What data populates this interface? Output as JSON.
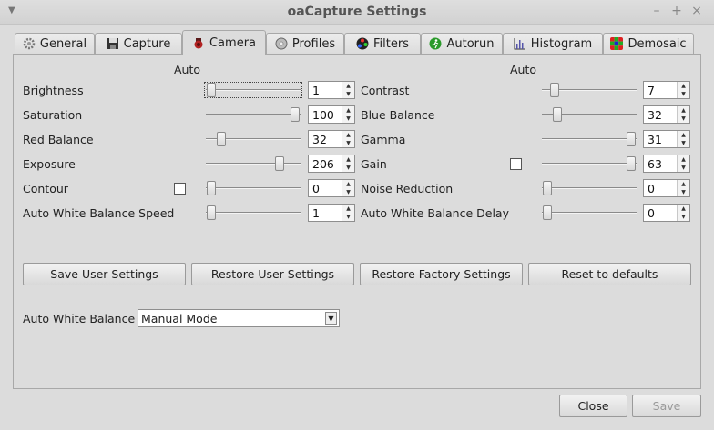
{
  "window": {
    "title": "oaCapture Settings",
    "menu_icon": "chevron-down-icon",
    "minimize_glyph": "–",
    "maximize_glyph": "+",
    "close_glyph": "×"
  },
  "tabs": [
    {
      "label": "General",
      "icon": "gear-icon"
    },
    {
      "label": "Capture",
      "icon": "floppy-icon"
    },
    {
      "label": "Camera",
      "icon": "camera-icon",
      "active": true
    },
    {
      "label": "Profiles",
      "icon": "disc-icon"
    },
    {
      "label": "Filters",
      "icon": "filter-wheel-icon"
    },
    {
      "label": "Autorun",
      "icon": "running-man-icon"
    },
    {
      "label": "Histogram",
      "icon": "histogram-icon"
    },
    {
      "label": "Demosaic",
      "icon": "bayer-grid-icon"
    }
  ],
  "camera": {
    "auto_header_left": "Auto",
    "auto_header_right": "Auto",
    "left_controls": [
      {
        "label": "Brightness",
        "value": "1"
      },
      {
        "label": "Saturation",
        "value": "100"
      },
      {
        "label": "Red Balance",
        "value": "32"
      },
      {
        "label": "Exposure",
        "value": "206"
      },
      {
        "label": "Contour",
        "value": "0",
        "auto_checkbox": false
      },
      {
        "label": "Auto White Balance Speed",
        "value": "1"
      }
    ],
    "right_controls": [
      {
        "label": "Contrast",
        "value": "7"
      },
      {
        "label": "Blue Balance",
        "value": "32"
      },
      {
        "label": "Gamma",
        "value": "31"
      },
      {
        "label": "Gain",
        "value": "63",
        "auto_checkbox": false
      },
      {
        "label": "Noise Reduction",
        "value": "0"
      },
      {
        "label": "Auto White Balance Delay",
        "value": "0"
      }
    ],
    "buttons": {
      "save_user": "Save User Settings",
      "restore_user": "Restore User Settings",
      "restore_factory": "Restore Factory Settings",
      "reset_defaults": "Reset to defaults"
    },
    "awb_mode": {
      "label": "Auto White Balance",
      "selected": "Manual Mode"
    }
  },
  "footer": {
    "close": "Close",
    "save": "Save"
  }
}
